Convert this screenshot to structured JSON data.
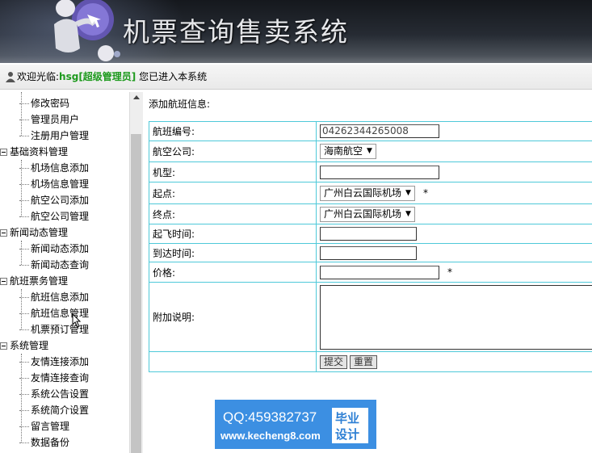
{
  "header": {
    "title": "机票查询售卖系统"
  },
  "welcome": {
    "prefix": "欢迎光临:",
    "user": "hsg[超级管理员]",
    "suffix": "您已进入本系统"
  },
  "sidebar": {
    "items": [
      {
        "type": "leaf",
        "label": "修改密码"
      },
      {
        "type": "leaf",
        "label": "管理员用户"
      },
      {
        "type": "leaf",
        "label": "注册用户管理"
      },
      {
        "type": "group",
        "label": "基础资料管理"
      },
      {
        "type": "leaf",
        "label": "机场信息添加"
      },
      {
        "type": "leaf",
        "label": "机场信息管理"
      },
      {
        "type": "leaf",
        "label": "航空公司添加"
      },
      {
        "type": "leaf",
        "label": "航空公司管理"
      },
      {
        "type": "group",
        "label": "新闻动态管理"
      },
      {
        "type": "leaf",
        "label": "新闻动态添加"
      },
      {
        "type": "leaf",
        "label": "新闻动态查询"
      },
      {
        "type": "group",
        "label": "航班票务管理"
      },
      {
        "type": "leaf",
        "label": "航班信息添加"
      },
      {
        "type": "leaf",
        "label": "航班信息管理"
      },
      {
        "type": "leaf",
        "label": "机票预订管理"
      },
      {
        "type": "group",
        "label": "系统管理"
      },
      {
        "type": "leaf",
        "label": "友情连接添加"
      },
      {
        "type": "leaf",
        "label": "友情连接查询"
      },
      {
        "type": "leaf",
        "label": "系统公告设置"
      },
      {
        "type": "leaf",
        "label": "系统简介设置"
      },
      {
        "type": "leaf",
        "label": "留言管理"
      },
      {
        "type": "leaf",
        "label": "数据备份"
      }
    ]
  },
  "main": {
    "title": "添加航班信息:",
    "form": {
      "flight_no": {
        "label": "航班编号:",
        "value": "04262344265008"
      },
      "airline": {
        "label": "航空公司:",
        "selected": "海南航空"
      },
      "model": {
        "label": "机型:",
        "value": ""
      },
      "origin": {
        "label": "起点:",
        "selected": "广州白云国际机场",
        "required": "*"
      },
      "destination": {
        "label": "终点:",
        "selected": "广州白云国际机场"
      },
      "depart_time": {
        "label": "起飞时间:",
        "value": ""
      },
      "arrive_time": {
        "label": "到达时间:",
        "value": ""
      },
      "price": {
        "label": "价格:",
        "value": "",
        "required": "*"
      },
      "notes": {
        "label": "附加说明:",
        "value": ""
      },
      "submit_label": "提交",
      "reset_label": "重置"
    }
  },
  "watermark": {
    "qq": "QQ:459382737",
    "url": "www.kecheng8.com",
    "badge_line1": "毕业",
    "badge_line2": "设计"
  },
  "colors": {
    "form_border": "#4fc9d9",
    "username": "#1e9a1e",
    "watermark_bg": "#3c8fe2"
  }
}
